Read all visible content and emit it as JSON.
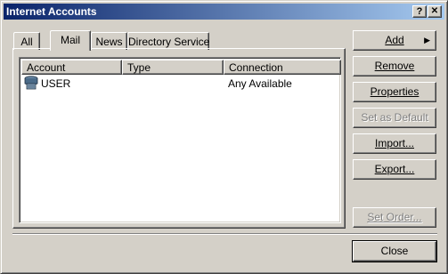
{
  "window": {
    "title": "Internet Accounts"
  },
  "titlebar_buttons": {
    "help": "?",
    "close": "✕"
  },
  "tabs": [
    {
      "label": "All"
    },
    {
      "label": "Mail"
    },
    {
      "label": "News"
    },
    {
      "label": "Directory Service"
    }
  ],
  "active_tab": "Mail",
  "list": {
    "columns": [
      "Account",
      "Type",
      "Connection"
    ],
    "rows": [
      {
        "account": "USER",
        "type": "",
        "connection": "Any Available",
        "icon": "mail-server-icon"
      }
    ]
  },
  "buttons": {
    "add": "Add",
    "remove": "Remove",
    "properties": "Properties",
    "set_default": "Set as Default",
    "import": "Import...",
    "export": "Export...",
    "set_order": "Set Order...",
    "close": "Close"
  },
  "colors": {
    "face": "#d4d0c8",
    "title_start": "#0a246a",
    "title_end": "#a6caf0",
    "disabled_text": "#808080"
  }
}
